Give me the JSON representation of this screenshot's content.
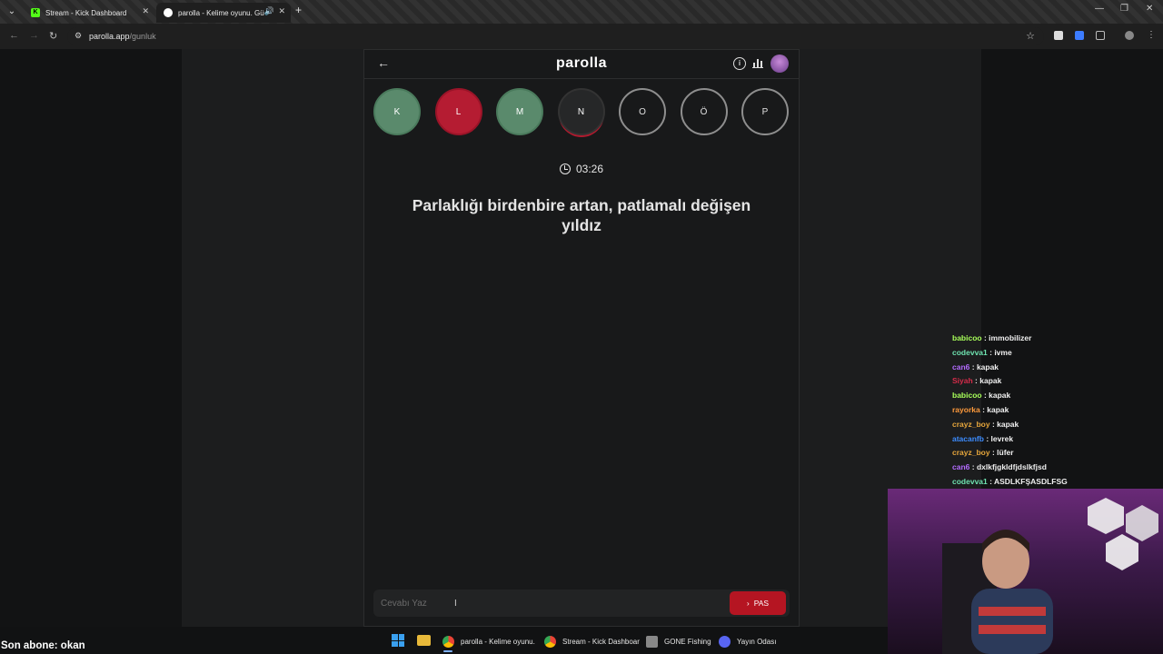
{
  "browser": {
    "tabs": [
      {
        "title": "Stream - Kick Dashboard"
      },
      {
        "title": "parolla - Kelime oyunu. Gü"
      }
    ],
    "url_host": "parolla.app",
    "url_path": "/gunluk"
  },
  "app": {
    "brand": "parolla",
    "letters": [
      {
        "letter": "K",
        "state": "correct"
      },
      {
        "letter": "L",
        "state": "wrong"
      },
      {
        "letter": "M",
        "state": "correct"
      },
      {
        "letter": "N",
        "state": "current"
      },
      {
        "letter": "O",
        "state": "pending"
      },
      {
        "letter": "Ö",
        "state": "pending"
      },
      {
        "letter": "P",
        "state": "pending"
      }
    ],
    "timer": "03:26",
    "question": "Parlaklığı birdenbire artan, patlamalı değişen yıldız",
    "answer_placeholder": "Cevabı Yaz",
    "pas_label": "PAS"
  },
  "chat": [
    {
      "user": "babicoo",
      "msg": "immobilizer",
      "color": "#a8ff5a"
    },
    {
      "user": "codevva1",
      "msg": "ivme",
      "color": "#6ee3b0"
    },
    {
      "user": "can6",
      "msg": "kapak",
      "color": "#b36cff"
    },
    {
      "user": "Siyah",
      "msg": "kapak",
      "color": "#d62c4a"
    },
    {
      "user": "babicoo",
      "msg": "kapak",
      "color": "#a8ff5a"
    },
    {
      "user": "rayorka",
      "msg": "kapak",
      "color": "#ff9a3c"
    },
    {
      "user": "crayz_boy",
      "msg": "kapak",
      "color": "#e6a63c"
    },
    {
      "user": "atacanfb",
      "msg": "levrek",
      "color": "#3c8cff"
    },
    {
      "user": "crayz_boy",
      "msg": "lüfer",
      "color": "#e6a63c"
    },
    {
      "user": "can6",
      "msg": "dxlkfjgkldfjdslkfjsd",
      "color": "#b36cff"
    },
    {
      "user": "codevva1",
      "msg": "ASDLKFŞASDLFSG",
      "color": "#6ee3b0"
    }
  ],
  "overlay": {
    "son_abone": "Son abone: okan"
  },
  "taskbar": {
    "items": [
      {
        "label": "parolla - Kelime oyunu."
      },
      {
        "label": "Stream - Kick Dashboar"
      },
      {
        "label": "GONE Fishing"
      },
      {
        "label": "Yayın Odası"
      }
    ]
  }
}
